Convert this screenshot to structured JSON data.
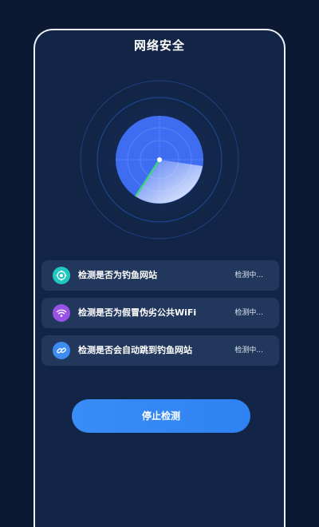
{
  "header": {
    "title": "网络安全"
  },
  "checks": [
    {
      "icon": "target-icon",
      "color": "#20c8c0",
      "label": "检测是否为钓鱼网站",
      "status": "检测中..."
    },
    {
      "icon": "wifi-icon",
      "color": "#9a52e6",
      "label": "检测是否为假冒伪劣公共WiFi",
      "status": "检测中..."
    },
    {
      "icon": "link-icon",
      "color": "#3d8cf0",
      "label": "检测是否会自动跳到钓鱼网站",
      "status": "检测中..."
    }
  ],
  "actions": {
    "stop_label": "停止检测"
  },
  "colors": {
    "background": "#0b1a32",
    "panel": "#122546",
    "card": "#22375c",
    "accent": "#3a8cf6",
    "radar": "#3f6df2"
  }
}
